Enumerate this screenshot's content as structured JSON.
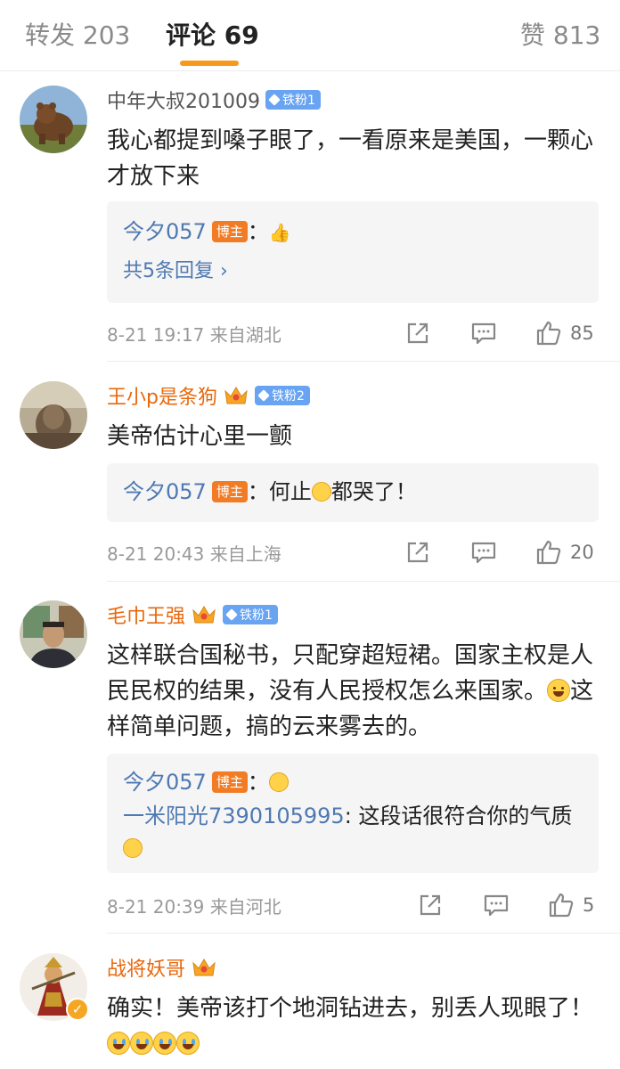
{
  "tabs": {
    "reposts": "转发 203",
    "comments": "评论 69",
    "likes": "赞 813"
  },
  "comments": [
    {
      "username": "中年大叔201009",
      "fan_badge": "铁粉1",
      "text": "我心都提到嗓子眼了，一看原来是美国，一颗心才放下来",
      "reply_user": "今夕057",
      "host_label": "博主",
      "reply_text": "：",
      "more_replies": "共5条回复",
      "time": "8-21 19:17",
      "location": "来自湖北",
      "likes": "85"
    },
    {
      "username": "王小p是条狗",
      "fan_badge": "铁粉2",
      "text": "美帝估计心里一颤",
      "reply_user": "今夕057",
      "host_label": "博主",
      "reply_text_a": "：何止",
      "reply_text_b": "都哭了！",
      "time": "8-21 20:43",
      "location": "来自上海",
      "likes": "20"
    },
    {
      "username": "毛巾王强",
      "fan_badge": "铁粉1",
      "text_a": "这样联合国秘书，只配穿超短裙。国家主权是人民民权的结果，没有人民授权怎么来国家。",
      "text_b": "这样简单问题，搞的云来雾去的。",
      "reply_user": "今夕057",
      "host_label": "博主",
      "reply_text": "：",
      "reply2_user": "一米阳光7390105995",
      "reply2_text": ": 这段话很符合你的气质",
      "time": "8-21 20:39",
      "location": "来自河北",
      "likes": "5"
    },
    {
      "username": "战将妖哥",
      "text": "确实！美帝该打个地洞钻进去，别丢人现眼了！"
    }
  ],
  "colors": {
    "accent": "#f79a1c",
    "link": "#4f79b2",
    "username_vip": "#e8680d",
    "fan_badge": "#68a4f2",
    "host_badge": "#f27c25"
  }
}
